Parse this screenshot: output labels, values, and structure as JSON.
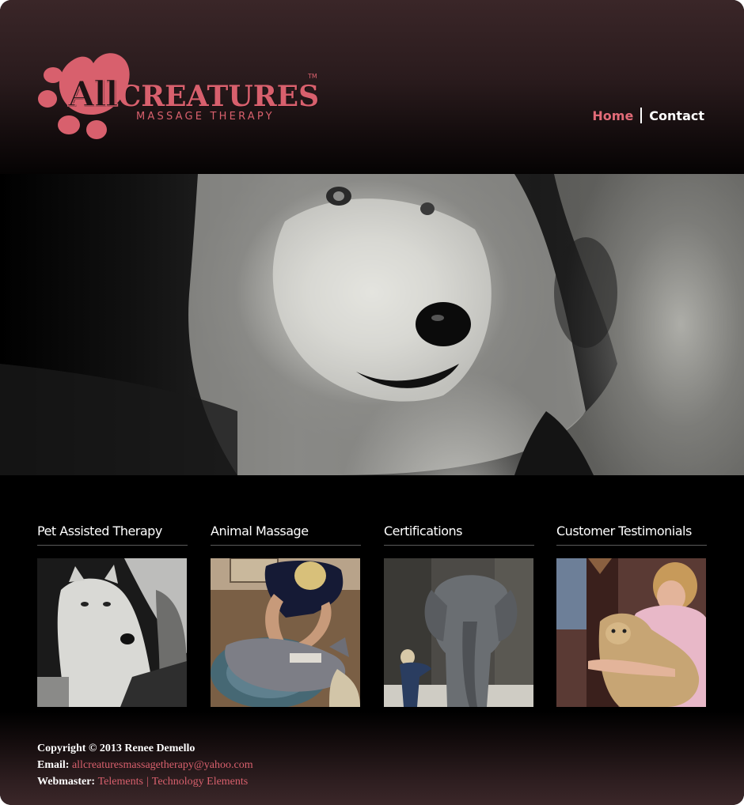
{
  "brand": {
    "logo_word_all": "All",
    "logo_word_creatures": "CREATURES",
    "logo_tm": "TM",
    "logo_subtitle": "MASSAGE THERAPY",
    "accent_color": "#d8606d"
  },
  "nav": {
    "items": [
      {
        "label": "Home",
        "active": true
      },
      {
        "label": "Contact",
        "active": false
      }
    ]
  },
  "features": [
    {
      "title": "Pet Assisted Therapy",
      "icon": "white-wolf-photo"
    },
    {
      "title": "Animal Massage",
      "icon": "dog-massage-photo"
    },
    {
      "title": "Certifications",
      "icon": "elephant-photo"
    },
    {
      "title": "Customer Testimonials",
      "icon": "lion-cub-photo"
    }
  ],
  "footer": {
    "copyright": "Copyright © 2013 Renee Demello",
    "email_label": "Email:",
    "email": "allcreaturesmassagetherapy@yahoo.com",
    "webmaster_label": "Webmaster:",
    "webmaster_link_1": "Telements",
    "webmaster_sep": "|",
    "webmaster_link_2": "Technology Elements"
  }
}
